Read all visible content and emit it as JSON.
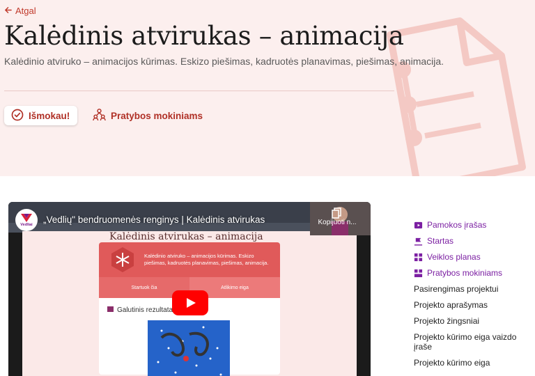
{
  "header": {
    "back_label": "Atgal",
    "title": "Kalėdinis atvirukas – animacija",
    "subtitle": "Kalėdinio atviruko – animacijos kūrimas. Eskizo piešimas, kadruotės planavimas, piešimas, animacija.",
    "learned_button": "Išmokau!",
    "exercises_link": "Pratybos mokiniams"
  },
  "video": {
    "title": "„Vedlių\" bendruomenės renginys | Kalėdinis atvirukas",
    "channel_label": "Vedliai",
    "copy_label": "Kopijuoti n...",
    "inner_title": "Kalėdinis atvirukas – animacija",
    "inner_description": "Kalėdinio atviruko – animacijos kūrimas. Eskizo piešimas, kadruotės planavimas, piešimas, animacija.",
    "inner_tab_start": "Startuok čia",
    "inner_tab_progress": "Atlikimo eiga",
    "inner_result": "Galutinis rezultatas"
  },
  "sidebar": {
    "items": [
      {
        "label": "Pamokos įrašas",
        "icon": "video-icon"
      },
      {
        "label": "Startas",
        "icon": "flag-icon"
      },
      {
        "label": "Veiklos planas",
        "icon": "plan-icon"
      },
      {
        "label": "Pratybos mokiniams",
        "icon": "exercises-icon"
      },
      {
        "label": "Pasirengimas projektui"
      },
      {
        "label": "Projekto aprašymas"
      },
      {
        "label": "Projekto žingsniai"
      },
      {
        "label": "Projekto kūrimo eiga vaizdo įraše"
      },
      {
        "label": "Projekto kūrimo eiga"
      }
    ]
  },
  "colors": {
    "accent": "#b03026",
    "hero_bg": "#fcefee",
    "nav_purple": "#7b1fa2"
  }
}
